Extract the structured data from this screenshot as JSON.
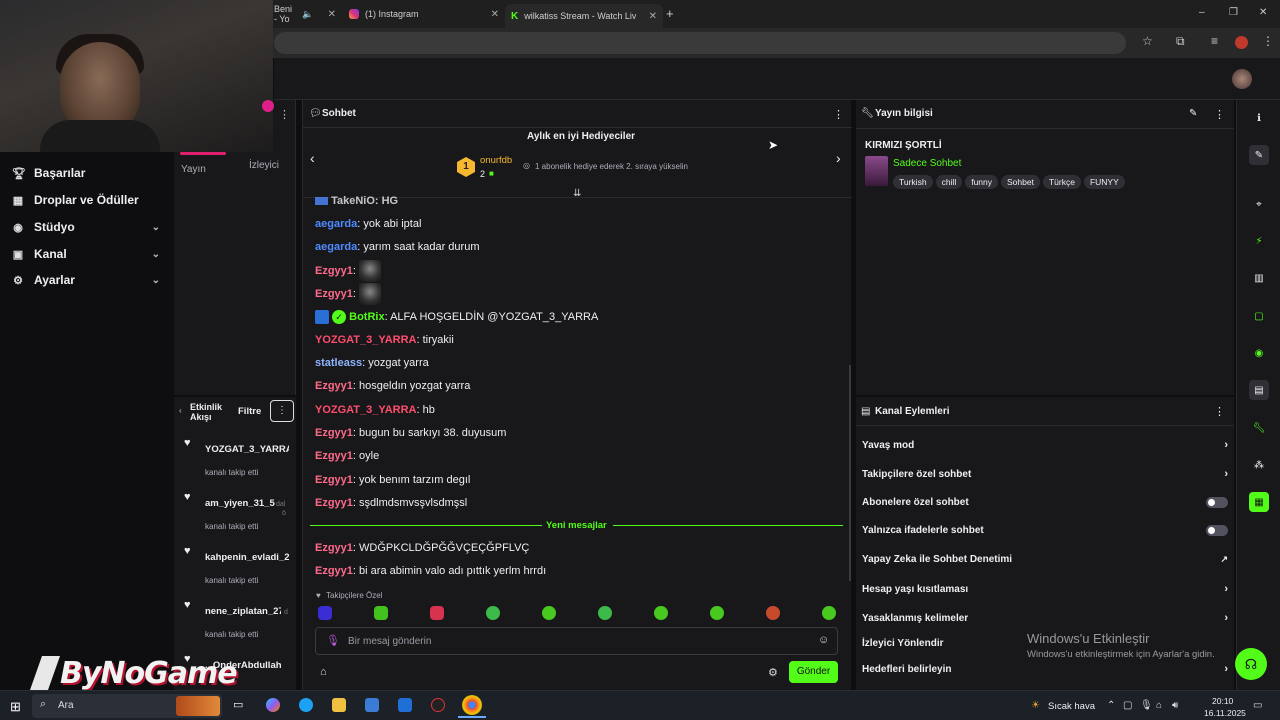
{
  "browser": {
    "tabs": [
      {
        "title": "Beni - Yo"
      },
      {
        "title": "(1) Instagram"
      },
      {
        "title": "wilkatiss Stream - Watch Live o"
      }
    ],
    "new_tab": "+",
    "window_controls": [
      "–",
      "❐",
      "✕"
    ]
  },
  "left_menu": {
    "items": [
      {
        "label": "Başarılar",
        "icon": "trophy-icon"
      },
      {
        "label": "Droplar ve Ödüller",
        "icon": "gift-icon"
      },
      {
        "label": "Stüdyo",
        "icon": "studio-icon",
        "expandable": true
      },
      {
        "label": "Kanal",
        "icon": "channel-icon",
        "expandable": true
      },
      {
        "label": "Ayarlar",
        "icon": "gear-icon",
        "expandable": true
      }
    ]
  },
  "middle": {
    "tab_stream": "Yayın",
    "tab_viewer": "İzleyici"
  },
  "activity": {
    "title": "Etkinlik Akışı",
    "filter": "Filtre",
    "items": [
      {
        "name": "YOZGAT_3_YARRA",
        "sub": "kanalı takip etti"
      },
      {
        "name": "am_yiyen_31_52",
        "suffix": "dal",
        "extra": "ö",
        "sub": "kanalı takip etti"
      },
      {
        "name": "kahpenin_evladi_2",
        "sub": "kanalı takip etti"
      },
      {
        "name": "nene_ziplatan_27",
        "suffix": "d",
        "sub": "kanalı takip etti"
      },
      {
        "name": "...OnderAbdullah",
        "sub": ""
      }
    ]
  },
  "chat": {
    "header": "Sohbet",
    "top_gifters_title": "Aylık en iyi Hediyeciler",
    "gifter_rank": "1",
    "gifter_name": "onurfdb",
    "gifter_count": "2",
    "gifter_hint": "1 abonelik hediye ederek 2. sıraya yükselin",
    "partial_top": "TakeNiO: HG",
    "messages": [
      {
        "user": "aegarda",
        "color": "#4f8bff",
        "text": "yok abi iptal"
      },
      {
        "user": "aegarda",
        "color": "#4f8bff",
        "text": "yarım saat kadar durum"
      },
      {
        "user": "Ezgyy1",
        "color": "#ff6b8a",
        "text": "",
        "emote": true
      },
      {
        "user": "Ezgyy1",
        "color": "#ff6b8a",
        "text": "",
        "emote": true
      },
      {
        "user": "BotRix",
        "color": "#53fc18",
        "text": "ALFA HOŞGELDİN @YOZGAT_3_YARRA",
        "bot": true
      },
      {
        "user": "YOZGAT_3_YARRA",
        "color": "#ff4d6d",
        "text": "tiryakii"
      },
      {
        "user": "statleass",
        "color": "#8fb4ff",
        "text": "yozgat yarra"
      },
      {
        "user": "Ezgyy1",
        "color": "#ff6b8a",
        "text": "hosgeldın yozgat yarra"
      },
      {
        "user": "YOZGAT_3_YARRA",
        "color": "#ff4d6d",
        "text": "hb"
      },
      {
        "user": "Ezgyy1",
        "color": "#ff6b8a",
        "text": "bugun bu sarkıyı 38. duyusum"
      },
      {
        "user": "Ezgyy1",
        "color": "#ff6b8a",
        "text": "oyle"
      },
      {
        "user": "Ezgyy1",
        "color": "#ff6b8a",
        "text": "yok benım tarzım degıl"
      },
      {
        "user": "Ezgyy1",
        "color": "#ff6b8a",
        "text": "sşdlmdsmvsşvlsdmşsl"
      }
    ],
    "new_messages_divider": "Yeni mesajlar",
    "new_messages": [
      {
        "user": "Ezgyy1",
        "color": "#ff6b8a",
        "text": "WDĞPKCLDĞPĞĞVÇEÇĞPFLVÇ"
      },
      {
        "user": "Ezgyy1",
        "color": "#ff6b8a",
        "text": "bi ara abimin valo adı pıttık yerlm hrrdı"
      }
    ],
    "followers_only_label": "Takipçilere Özel",
    "input_placeholder": "Bir mesaj gönderin",
    "send_button": "Gönder"
  },
  "stream_info": {
    "title": "Yayın bilgisi",
    "stream_title": "KIRMIZI ŞORTLİ",
    "category": "Sadece Sohbet",
    "tags": [
      "Turkish",
      "chill",
      "funny",
      "Sohbet",
      "Türkçe",
      "FUNYY"
    ]
  },
  "channel_actions": {
    "title": "Kanal Eylemleri",
    "items": [
      {
        "label": "Yavaş mod",
        "control": "chevron"
      },
      {
        "label": "Takipçilere özel sohbet",
        "control": "chevron"
      },
      {
        "label": "Abonelere özel sohbet",
        "control": "toggle"
      },
      {
        "label": "Yalnızca ifadelerle sohbet",
        "control": "toggle"
      },
      {
        "label": "Yapay Zeka ile Sohbet Denetimi",
        "control": "external"
      },
      {
        "label": "Hesap yaşı kısıtlaması",
        "control": "chevron"
      },
      {
        "label": "Yasaklanmış kelimeler",
        "control": "chevron"
      },
      {
        "label": "İzleyici Yönlendir",
        "control": "none"
      },
      {
        "label": "Hedefleri belirleyin",
        "control": "chevron"
      }
    ]
  },
  "overlay": {
    "logo_text": "ByNoGame",
    "windows_activate_title": "Windows'u Etkinleştir",
    "windows_activate_sub": "Windows'u etkinleştirmek için Ayarlar'a gidin."
  },
  "taskbar": {
    "search": "Ara",
    "weather": "Sıcak hava",
    "time": "20:10",
    "date": "16.11.2025"
  },
  "colors": {
    "kick_green": "#53fc18",
    "panel": "#18181b",
    "page": "#0e0e10"
  }
}
